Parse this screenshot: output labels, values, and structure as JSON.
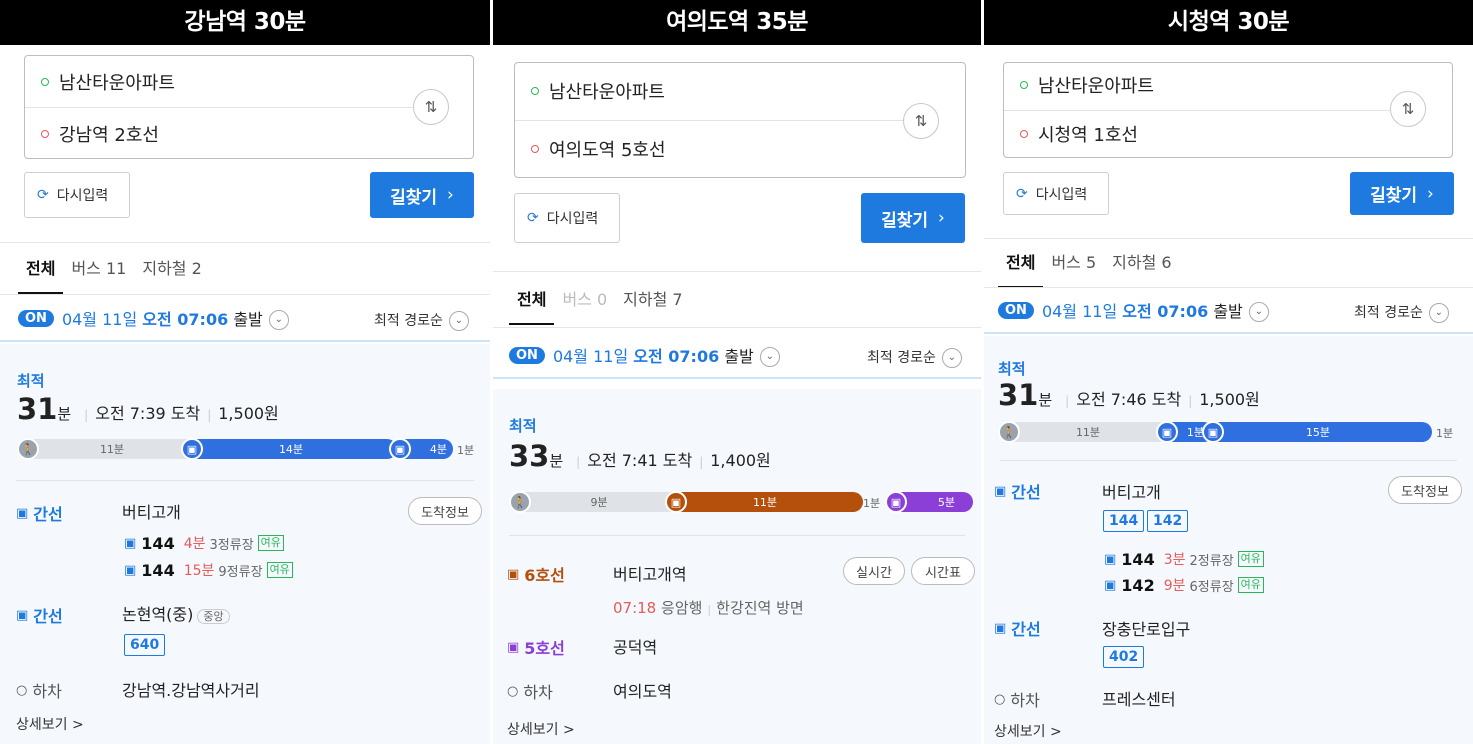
{
  "panels": [
    {
      "title": "강남역 30분",
      "from": "남산타운아파트",
      "to": "강남역 2호선",
      "swap_icon": "swap-icon",
      "reset_label": "다시입력",
      "search_label": "길찾기",
      "tabs": [
        "전체",
        "버스 11",
        "지하철 2"
      ],
      "on_badge": "ON",
      "depart_date": "04월 11일",
      "depart_time": "오전 07:06",
      "depart_word": "출발",
      "sort_label": "최적 경로순",
      "best_label": "최적",
      "minutes": "31",
      "minutes_unit": "분",
      "arrival": "오전 7:39 도착",
      "fare": "1,500원",
      "timeline": [
        "11분",
        "14분",
        "4분",
        "1분"
      ],
      "steps": [
        {
          "label": "간선",
          "stop": "버티고개",
          "action": "도착정보"
        },
        {
          "label": "간선",
          "stop": "논현역(중)",
          "tag": "중앙",
          "route": "640"
        },
        {
          "label": "하차",
          "stop": "강남역.강남역사거리"
        }
      ],
      "arrivals": [
        {
          "bus": "144",
          "time": "4분",
          "stops": "3정류장",
          "status": "여유"
        },
        {
          "bus": "144",
          "time": "15분",
          "stops": "9정류장",
          "status": "여유"
        }
      ],
      "more_label": "상세보기 >"
    },
    {
      "title": "여의도역 35분",
      "from": "남산타운아파트",
      "to": "여의도역 5호선",
      "reset_label": "다시입력",
      "search_label": "길찾기",
      "tabs": [
        "전체",
        "버스 0",
        "지하철 7"
      ],
      "on_badge": "ON",
      "depart_date": "04월 11일",
      "depart_time": "오전 07:06",
      "depart_word": "출발",
      "sort_label": "최적 경로순",
      "best_label": "최적",
      "minutes": "33",
      "minutes_unit": "분",
      "arrival": "오전 7:41 도착",
      "fare": "1,400원",
      "timeline": [
        "9분",
        "11분",
        "1분",
        "5분"
      ],
      "steps": [
        {
          "label": "6호선",
          "stop": "버티고개역",
          "action1": "실시간",
          "action2": "시간표"
        },
        {
          "label": "5호선",
          "stop": "공덕역"
        },
        {
          "label": "하차",
          "stop": "여의도역"
        }
      ],
      "train": {
        "time": "07:18",
        "dest": "응암행",
        "dir": "한강진역 방면"
      },
      "more_label": "상세보기 >"
    },
    {
      "title": "시청역 30분",
      "from": "남산타운아파트",
      "to": "시청역 1호선",
      "reset_label": "다시입력",
      "search_label": "길찾기",
      "tabs": [
        "전체",
        "버스 5",
        "지하철 6"
      ],
      "on_badge": "ON",
      "depart_date": "04월 11일",
      "depart_time": "오전 07:06",
      "depart_word": "출발",
      "sort_label": "최적 경로순",
      "best_label": "최적",
      "minutes": "31",
      "minutes_unit": "분",
      "arrival": "오전 7:46 도착",
      "fare": "1,500원",
      "timeline": [
        "11분",
        "1분",
        "15분",
        "1분"
      ],
      "steps": [
        {
          "label": "간선",
          "stop": "버티고개",
          "action": "도착정보",
          "routes": [
            "144",
            "142"
          ]
        },
        {
          "label": "간선",
          "stop": "장충단로입구",
          "route": "402"
        },
        {
          "label": "하차",
          "stop": "프레스센터"
        }
      ],
      "arrivals": [
        {
          "bus": "144",
          "time": "3분",
          "stops": "2정류장",
          "status": "여유"
        },
        {
          "bus": "142",
          "time": "9분",
          "stops": "6정류장",
          "status": "여유"
        }
      ],
      "more_label": "상세보기 >"
    }
  ]
}
